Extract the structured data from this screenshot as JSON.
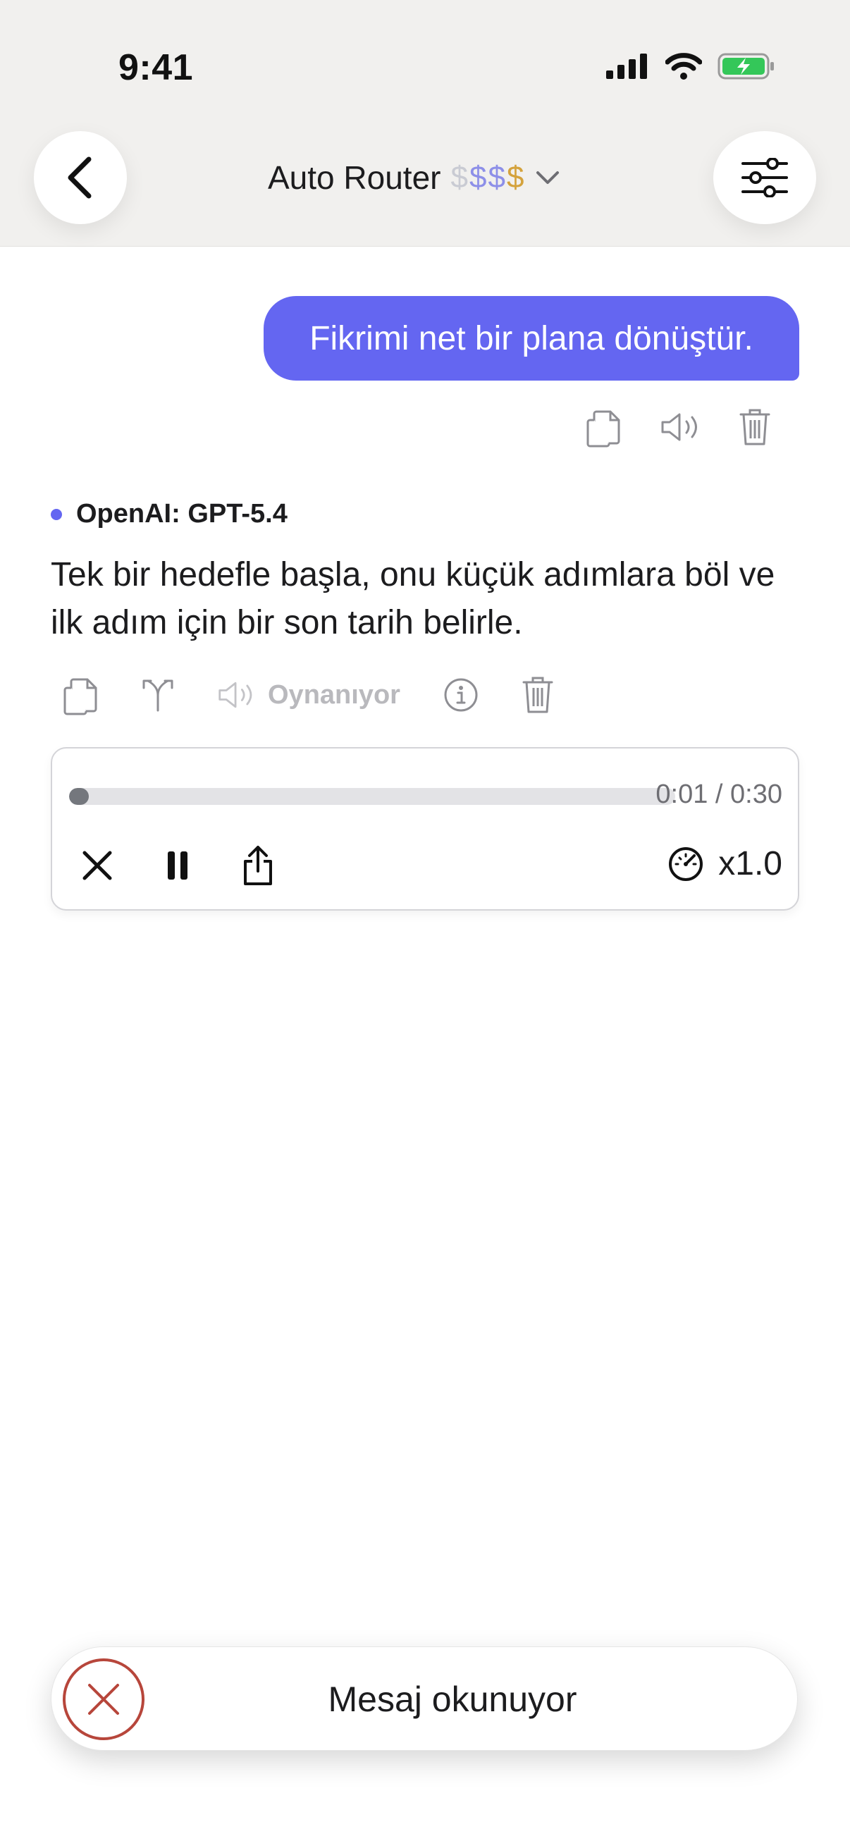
{
  "status_bar": {
    "time": "9:41",
    "icons": [
      "cellular-signal-icon",
      "wifi-icon",
      "battery-charging-icon"
    ]
  },
  "header": {
    "title": "Auto Router",
    "price_symbols": [
      {
        "char": "$",
        "color": "#c9cbd3"
      },
      {
        "char": "$",
        "color": "#8d8fe8"
      },
      {
        "char": "$",
        "color": "#8d8fe8"
      },
      {
        "char": "$",
        "color": "#d4a23c"
      }
    ],
    "icons": [
      "back-chevron-icon",
      "chevron-down-icon",
      "sliders-icon"
    ]
  },
  "user_message": {
    "text": "Fikrimi net bir plana dönüştür.",
    "actions": [
      "copy-icon",
      "speaker-icon",
      "trash-icon"
    ]
  },
  "assistant_message": {
    "model": "OpenAI: GPT-5.4",
    "text": "Tek bir hedefle başla, onu küçük adımlara böl ve ilk adım için bir son tarih belirle.",
    "actions": [
      "copy-icon",
      "branch-icon",
      "speaker-icon",
      "info-icon",
      "trash-icon"
    ],
    "playing_label": "Oynanıyor"
  },
  "player": {
    "time": "0:01 / 0:30",
    "progress_fraction": 0.033,
    "speed": "x1.0",
    "controls": [
      "close-icon",
      "pause-icon",
      "share-icon",
      "speedometer-icon"
    ]
  },
  "reading_bar": {
    "label": "Mesaj okunuyor"
  },
  "colors": {
    "accent": "#6466f1",
    "header_bg": "#f1f0ee",
    "stop_red": "#b7463b"
  }
}
